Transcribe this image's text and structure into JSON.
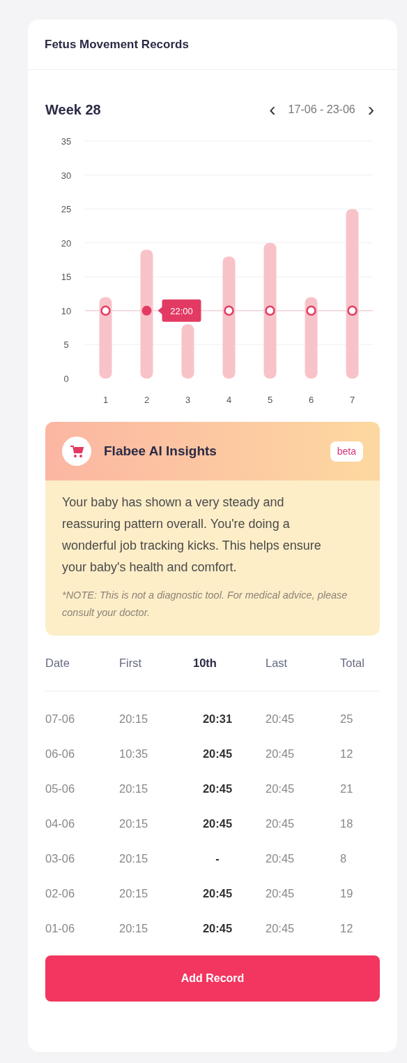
{
  "card_title": "Fetus Movement Records",
  "week": {
    "label": "Week 28",
    "prev_icon": "‹",
    "range": "17-06 - 23-06",
    "next_icon": "›"
  },
  "chart": {
    "chart_data": {
      "type": "bar",
      "categories": [
        "1",
        "2",
        "3",
        "4",
        "5",
        "6",
        "7"
      ],
      "ylim": [
        0,
        35
      ],
      "yticks": [
        0,
        5,
        10,
        15,
        20,
        25,
        30,
        35
      ],
      "grid": true,
      "series": [
        {
          "color": "#f8c3c8",
          "values": [
            12,
            19,
            8,
            18,
            20,
            12,
            25
          ]
        }
      ],
      "ref_lines": [
        {
          "axis": "y",
          "value": 10,
          "color": "#f3d3da"
        }
      ],
      "annotations": [
        {
          "x": "2",
          "y": 10,
          "text": "22:00"
        }
      ]
    }
  },
  "insights": {
    "title": "Flabee AI Insights",
    "badge": "beta",
    "text": "Your baby has shown a very steady and reassuring pattern overall. You're doing a wonderful job tracking kicks. This helps ensure your baby's health and comfort.",
    "note": "*NOTE: This is not a diagnostic tool. For medical advice, please consult your doctor."
  },
  "table": {
    "columns": [
      {
        "label": "Date",
        "bold": false
      },
      {
        "label": "First",
        "bold": false
      },
      {
        "label": "10th",
        "bold": true
      },
      {
        "label": "Last",
        "bold": false
      },
      {
        "label": "Total",
        "bold": false
      }
    ],
    "rows": [
      [
        "07-06",
        "20:15",
        "20:31",
        "20:45",
        "25"
      ],
      [
        "06-06",
        "10:35",
        "20:45",
        "20:45",
        "12"
      ],
      [
        "05-06",
        "20:15",
        "20:45",
        "20:45",
        "21"
      ],
      [
        "04-06",
        "20:15",
        "20:45",
        "20:45",
        "18"
      ],
      [
        "03-06",
        "20:15",
        "-",
        "20:45",
        "8"
      ],
      [
        "02-06",
        "20:15",
        "20:45",
        "20:45",
        "19"
      ],
      [
        "01-06",
        "20:15",
        "20:45",
        "20:45",
        "12"
      ]
    ]
  },
  "button": "Add Record"
}
